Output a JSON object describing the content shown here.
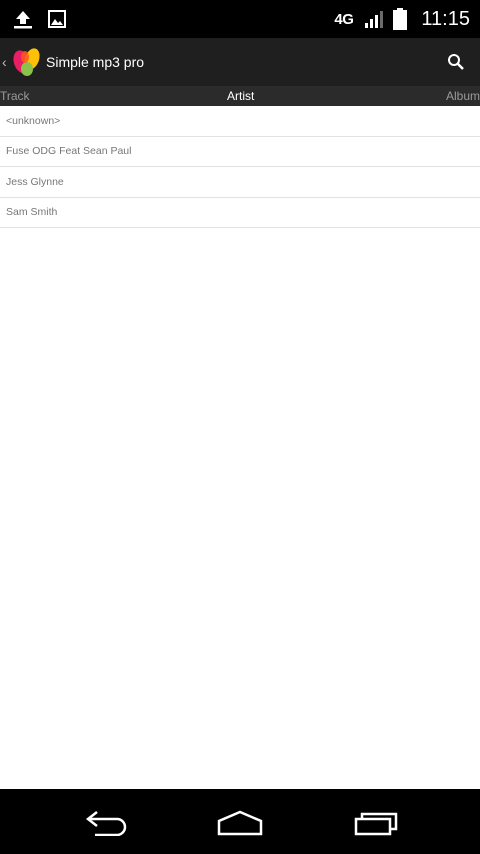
{
  "status_bar": {
    "network_label": "4G",
    "time": "11:15",
    "icons": [
      "upload-icon",
      "image-icon",
      "signal-icon",
      "battery-icon"
    ]
  },
  "action_bar": {
    "title": "Simple mp3 pro",
    "up_caret": "‹",
    "logo": "app-logo",
    "search_icon": "search-icon"
  },
  "tabs": [
    {
      "label": "Track"
    },
    {
      "label": "Artist"
    },
    {
      "label": "Album"
    }
  ],
  "selected_tab": "Artist",
  "artists": [
    {
      "name": "<unknown>"
    },
    {
      "name": "Fuse ODG Feat Sean Paul"
    },
    {
      "name": "Jess Glynne"
    },
    {
      "name": "Sam Smith"
    }
  ],
  "nav_bar": {
    "icons": [
      "back-icon",
      "home-icon",
      "recents-icon"
    ]
  },
  "colors": {
    "status_bg": "#000000",
    "action_bar_bg": "#1f1f1f",
    "tab_strip_bg": "#2b2b2b",
    "list_text": "#777777",
    "divider": "#e2e2e2"
  }
}
